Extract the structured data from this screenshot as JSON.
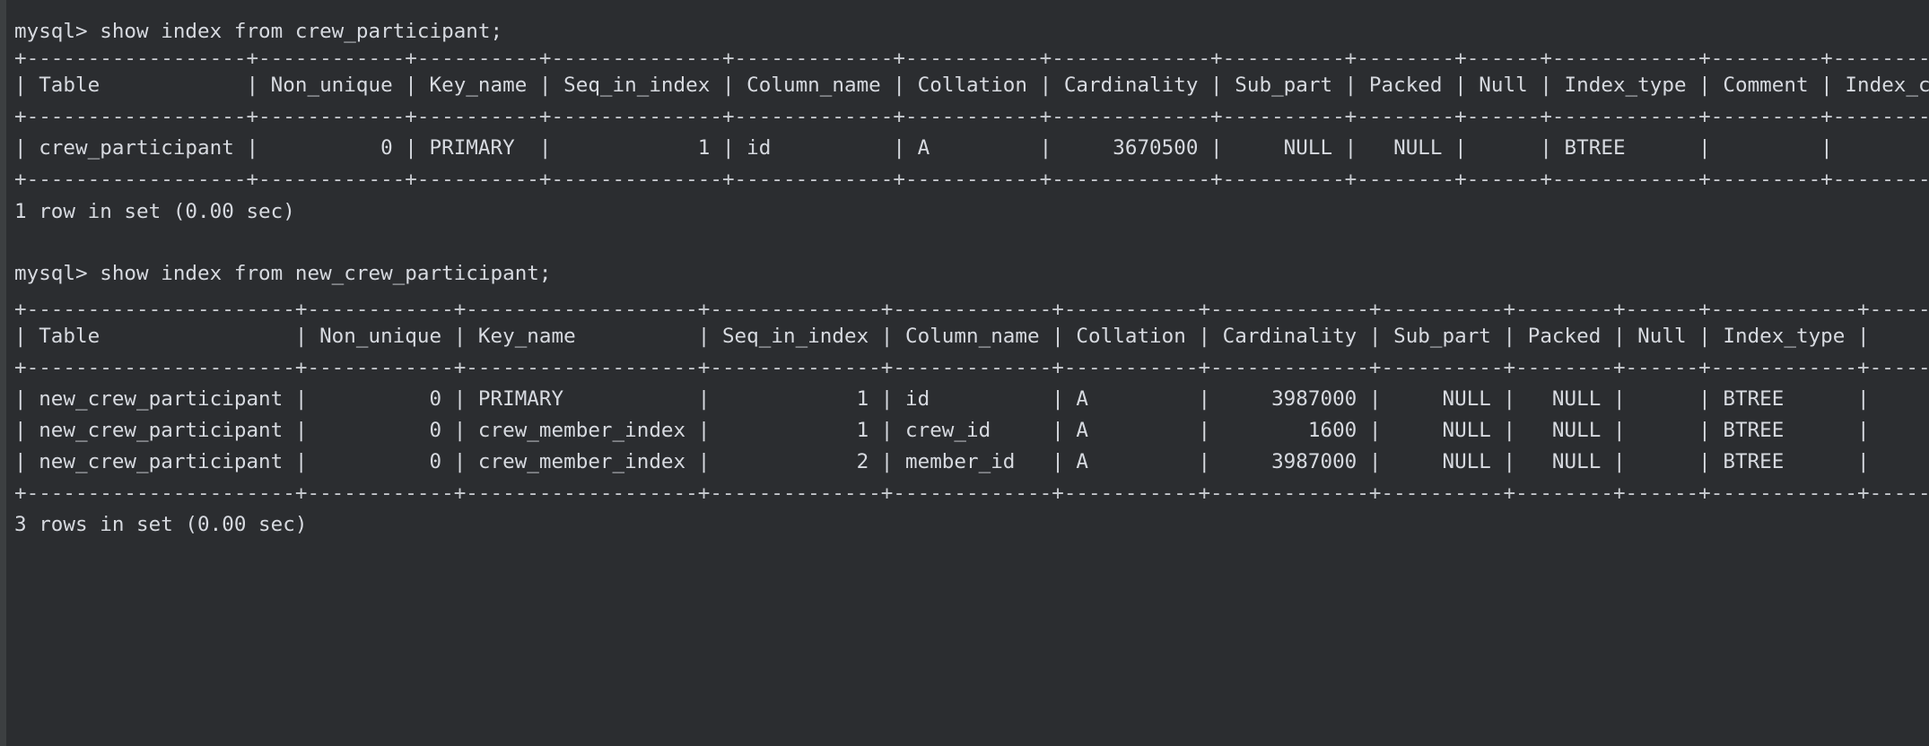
{
  "terminal": {
    "lines": [
      "mysql> show index from crew_participant;",
      "+------------------+------------+----------+--------------+-------------+-----------+-------------+----------+--------+------+------------+---------+---------------+---------+------------+",
      "| Table            | Non_unique | Key_name | Seq_in_index | Column_name | Collation | Cardinality | Sub_part | Packed | Null | Index_type | Comment | Index_comment | Visible | Expression |",
      "+------------------+------------+----------+--------------+-------------+-----------+-------------+----------+--------+------+------------+---------+---------------+---------+------------+",
      "| crew_participant |          0 | PRIMARY  |            1 | id          | A         |     3670500 |     NULL |   NULL |      | BTREE      |         |",
      "+------------------+------------+----------+--------------+-------------+-----------+-------------+----------+--------+------+------------+---------+---------------+---------+------------+",
      "1 row in set (0.00 sec)",
      "",
      "mysql> show index from new_crew_participant;",
      "+----------------------+------------+-------------------+--------------+-------------+-----------+-------------+----------+--------+------+------------+---------+---------------+---------+------------+",
      "| Table                | Non_unique | Key_name          | Seq_in_index | Column_name | Collation | Cardinality | Sub_part | Packed | Null | Index_type |",
      "+----------------------+------------+-------------------+--------------+-------------+-----------+-------------+----------+--------+------+------------+---------+---------------+---------+------------+",
      "| new_crew_participant |          0 | PRIMARY           |            1 | id          | A         |     3987000 |     NULL |   NULL |      | BTREE      |",
      "| new_crew_participant |          0 | crew_member_index |            1 | crew_id     | A         |        1600 |     NULL |   NULL |      | BTREE      |",
      "| new_crew_participant |          0 | crew_member_index |            2 | member_id   | A         |     3987000 |     NULL |   NULL |      | BTREE      |",
      "+----------------------+------------+-------------------+--------------+-------------+-----------+-------------+----------+--------+------+------------+---------+---------------+---------+------------+",
      "3 rows in set (0.00 sec)"
    ]
  }
}
